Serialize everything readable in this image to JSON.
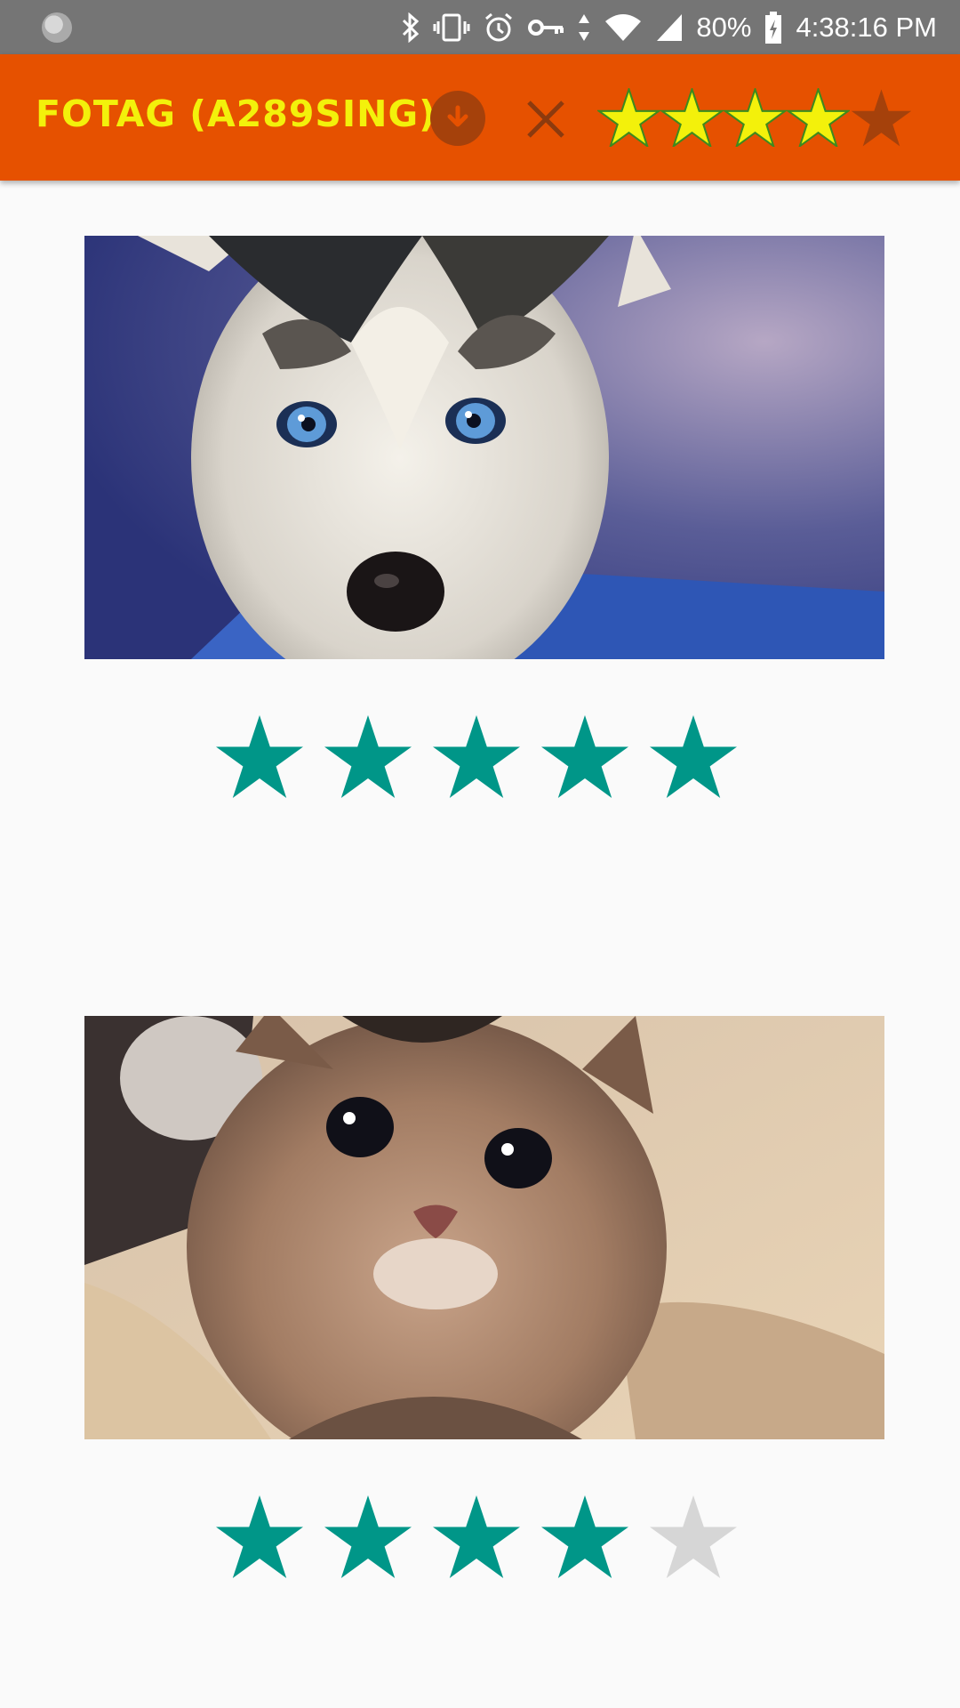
{
  "status_bar": {
    "battery": "80%",
    "time": "4:38:16 PM",
    "icons": [
      "bluetooth-icon",
      "vibrate-icon",
      "alarm-icon",
      "vpn-key-icon",
      "data-arrows-icon",
      "wifi-icon",
      "signal-icon",
      "battery-charging-icon"
    ]
  },
  "app_bar": {
    "title": "FOTAG (A289SING)",
    "load_icon": "download-circle-icon",
    "clear_icon": "close-icon",
    "filter_rating": 4,
    "filter_max": 5,
    "colors": {
      "background": "#e65100",
      "title": "#f3f10b",
      "star_active": "#f3f10b",
      "star_inactive": "#a5410b"
    }
  },
  "photos": [
    {
      "subject": "husky puppy",
      "rating": 5,
      "max": 5
    },
    {
      "subject": "tabby kitten",
      "rating": 4,
      "max": 5
    }
  ],
  "colors": {
    "rating_filled": "#009688",
    "rating_empty": "#d6d6d6",
    "background": "#fafafa"
  }
}
